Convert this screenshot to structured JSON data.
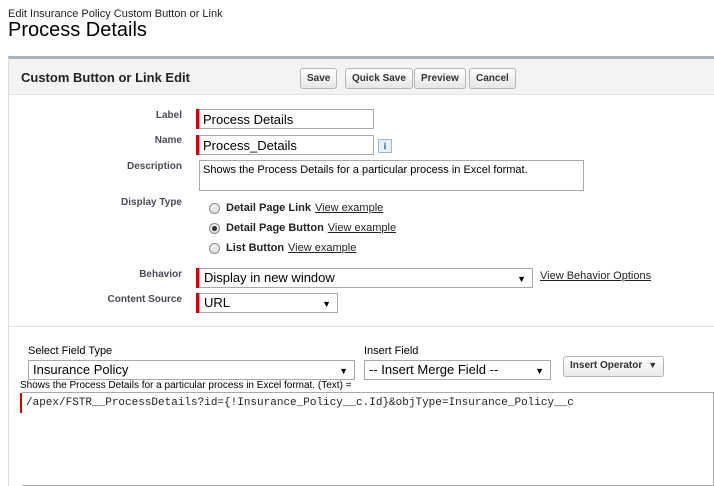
{
  "header": {
    "breadcrumb": "Edit Insurance Policy Custom Button or Link",
    "title": "Process Details"
  },
  "panel": {
    "title": "Custom Button or Link Edit",
    "buttons": {
      "save": "Save",
      "quick_save": "Quick Save",
      "preview": "Preview",
      "cancel": "Cancel"
    }
  },
  "form": {
    "label": {
      "label": "Label",
      "value": "Process Details"
    },
    "name": {
      "label": "Name",
      "value": "Process_Details",
      "info": "i"
    },
    "description": {
      "label": "Description",
      "value": "Shows the Process Details for a particular process in Excel format."
    },
    "display_type": {
      "label": "Display Type",
      "options": [
        {
          "label": "Detail Page Link",
          "link": "View example",
          "selected": false
        },
        {
          "label": "Detail Page Button",
          "link": "View example",
          "selected": true
        },
        {
          "label": "List Button",
          "link": "View example",
          "selected": false
        }
      ]
    },
    "behavior": {
      "label": "Behavior",
      "value": "Display in new window",
      "link": "View Behavior Options"
    },
    "content_source": {
      "label": "Content Source",
      "value": "URL"
    }
  },
  "formula_section": {
    "select_field_type": {
      "label": "Select Field Type",
      "value": "Insurance Policy"
    },
    "insert_field": {
      "label": "Insert Field",
      "value": "-- Insert Merge Field --"
    },
    "insert_operator": "Insert Operator",
    "hint": "Shows the Process Details for a particular process in Excel format. (Text) =",
    "formula": "/apex/FSTR__ProcessDetails?id={!Insurance_Policy__c.Id}&objType=Insurance_Policy__c"
  },
  "icons": {
    "dropdown": "chevron-down-icon",
    "info": "info-icon"
  }
}
